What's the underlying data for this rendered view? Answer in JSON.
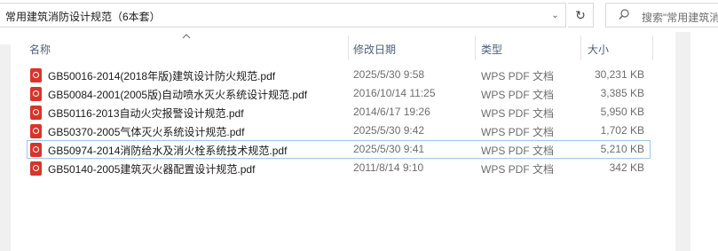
{
  "address_bar": {
    "path": "常用建筑消防设计规范（6本套）",
    "dropdown_glyph": "⌄",
    "refresh_glyph": "↻"
  },
  "search": {
    "placeholder": "搜索\"常用建筑消",
    "icon": "search-icon"
  },
  "columns": {
    "name": "名称",
    "date": "修改日期",
    "type": "类型",
    "size": "大小",
    "sorted_by": "名称"
  },
  "files": [
    {
      "name": "GB50016-2014(2018年版)建筑设计防火规范.pdf",
      "modified": "2025/5/30 9:58",
      "type": "WPS PDF 文档",
      "size": "30,231 KB",
      "focused": false
    },
    {
      "name": "GB50084-2001(2005版)自动喷水灭火系统设计规范.pdf",
      "modified": "2016/10/14 11:25",
      "type": "WPS PDF 文档",
      "size": "3,385 KB",
      "focused": false
    },
    {
      "name": "GB50116-2013自动火灾报警设计规范.pdf",
      "modified": "2014/6/17 19:26",
      "type": "WPS PDF 文档",
      "size": "5,950 KB",
      "focused": false
    },
    {
      "name": "GB50370-2005气体灭火系统设计规范.pdf",
      "modified": "2025/5/30 9:42",
      "type": "WPS PDF 文档",
      "size": "1,702 KB",
      "focused": false
    },
    {
      "name": "GB50974-2014消防给水及消火栓系统技术规范.pdf",
      "modified": "2025/5/30 9:41",
      "type": "WPS PDF 文档",
      "size": "5,210 KB",
      "focused": true
    },
    {
      "name": "GB50140-2005建筑灭火器配置设计规范.pdf",
      "modified": "2011/8/14 9:10",
      "type": "WPS PDF 文档",
      "size": "342 KB",
      "focused": false
    }
  ],
  "colors": {
    "header_text": "#4c607a",
    "focus_border": "#99c9ef",
    "pdf_icon": "#d9342b"
  }
}
